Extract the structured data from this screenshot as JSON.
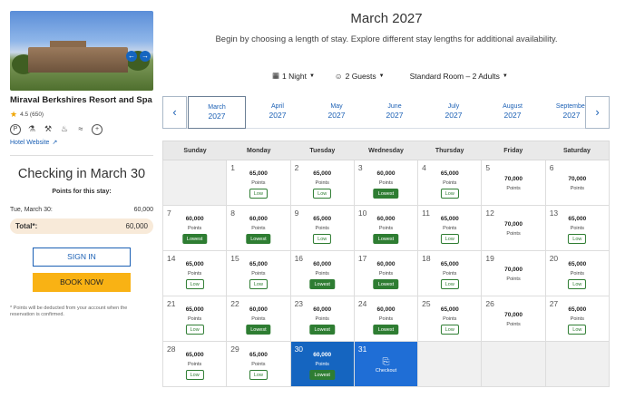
{
  "hotel": {
    "name": "Miraval Berkshires Resort and Spa",
    "rating": "4.5 (650)",
    "website": "Hotel Website"
  },
  "stay": {
    "checking": "Checking in March 30",
    "points_for": "Points for this stay:",
    "line_date": "Tue, March 30:",
    "line_points": "60,000",
    "total_label": "Total*:",
    "total_points": "60,000",
    "sign_in": "SIGN IN",
    "book_now": "BOOK NOW",
    "note": "* Points will be deducted from your account when the reservation is confirmed."
  },
  "header": {
    "title": "March 2027",
    "subtitle": "Begin by choosing a length of stay. Explore different stay lengths for additional availability."
  },
  "filters": {
    "nights": "1 Night",
    "guests": "2 Guests",
    "room": "Standard Room – 2 Adults"
  },
  "months": [
    {
      "m": "March",
      "y": "2027"
    },
    {
      "m": "April",
      "y": "2027"
    },
    {
      "m": "May",
      "y": "2027"
    },
    {
      "m": "June",
      "y": "2027"
    },
    {
      "m": "July",
      "y": "2027"
    },
    {
      "m": "August",
      "y": "2027"
    },
    {
      "m": "September",
      "y": "2027"
    }
  ],
  "weekdays": [
    "Sunday",
    "Monday",
    "Tuesday",
    "Wednesday",
    "Thursday",
    "Friday",
    "Saturday"
  ],
  "points_label": "Points",
  "checkout_label": "Checkout",
  "days": [
    {
      "d": "",
      "empty": true
    },
    {
      "d": "1",
      "pts": "65,000",
      "badge": "Low"
    },
    {
      "d": "2",
      "pts": "65,000",
      "badge": "Low"
    },
    {
      "d": "3",
      "pts": "60,000",
      "badge": "Lowest"
    },
    {
      "d": "4",
      "pts": "65,000",
      "badge": "Low"
    },
    {
      "d": "5",
      "pts": "70,000",
      "badge": ""
    },
    {
      "d": "6",
      "pts": "70,000",
      "badge": ""
    },
    {
      "d": "7",
      "pts": "60,000",
      "badge": "Lowest"
    },
    {
      "d": "8",
      "pts": "60,000",
      "badge": "Lowest"
    },
    {
      "d": "9",
      "pts": "65,000",
      "badge": "Low"
    },
    {
      "d": "10",
      "pts": "60,000",
      "badge": "Lowest"
    },
    {
      "d": "11",
      "pts": "65,000",
      "badge": "Low"
    },
    {
      "d": "12",
      "pts": "70,000",
      "badge": ""
    },
    {
      "d": "13",
      "pts": "65,000",
      "badge": "Low"
    },
    {
      "d": "14",
      "pts": "65,000",
      "badge": "Low"
    },
    {
      "d": "15",
      "pts": "65,000",
      "badge": "Low"
    },
    {
      "d": "16",
      "pts": "60,000",
      "badge": "Lowest"
    },
    {
      "d": "17",
      "pts": "60,000",
      "badge": "Lowest"
    },
    {
      "d": "18",
      "pts": "65,000",
      "badge": "Low"
    },
    {
      "d": "19",
      "pts": "70,000",
      "badge": ""
    },
    {
      "d": "20",
      "pts": "65,000",
      "badge": "Low"
    },
    {
      "d": "21",
      "pts": "65,000",
      "badge": "Low"
    },
    {
      "d": "22",
      "pts": "60,000",
      "badge": "Lowest"
    },
    {
      "d": "23",
      "pts": "60,000",
      "badge": "Lowest"
    },
    {
      "d": "24",
      "pts": "60,000",
      "badge": "Lowest"
    },
    {
      "d": "25",
      "pts": "65,000",
      "badge": "Low"
    },
    {
      "d": "26",
      "pts": "70,000",
      "badge": ""
    },
    {
      "d": "27",
      "pts": "65,000",
      "badge": "Low"
    },
    {
      "d": "28",
      "pts": "65,000",
      "badge": "Low"
    },
    {
      "d": "29",
      "pts": "65,000",
      "badge": "Low"
    },
    {
      "d": "30",
      "pts": "60,000",
      "badge": "Lowest",
      "selected": true
    },
    {
      "d": "31",
      "checkout": true
    },
    {
      "d": "",
      "empty": true
    },
    {
      "d": "",
      "empty": true
    },
    {
      "d": "",
      "empty": true
    }
  ],
  "colors": {
    "primary": "#1565c0",
    "book": "#f9b214",
    "lowest": "#2e7d32"
  }
}
